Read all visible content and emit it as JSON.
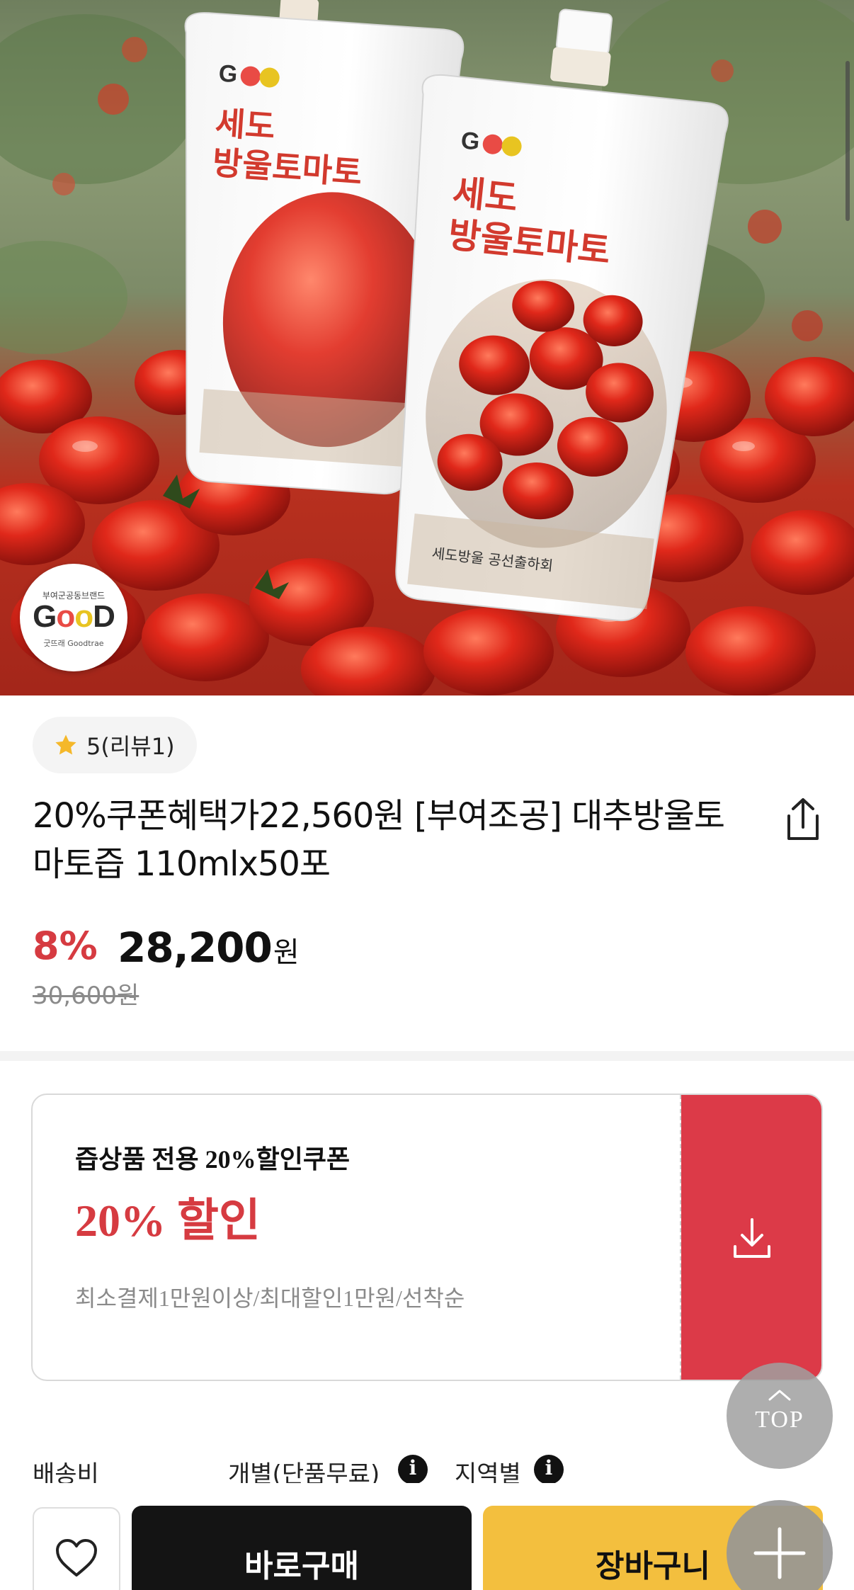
{
  "hero": {
    "badge_sub": "부여군공동브랜드",
    "badge_logo_parts": [
      "G",
      "o",
      "o",
      "D"
    ],
    "badge_name": "굿뜨래 Goodtrae"
  },
  "rating": {
    "label": "5(리뷰1)",
    "icon": "star-icon",
    "icon_color": "#f5b82a"
  },
  "product": {
    "title": "20%쿠폰혜택가22,560원 [부여조공] 대추방울토마토즙 110mlx50포",
    "discount_rate": "8%",
    "price": "28,200",
    "price_unit": "원",
    "original_price": "30,600원"
  },
  "coupon": {
    "title": "즙상품 전용 20%할인쿠폰",
    "discount": "20% 할인",
    "conditions": "최소결제1만원이상/최대할인1만원/선착순",
    "download_icon": "download-icon",
    "accent_color": "#dc3a48"
  },
  "shipping": {
    "label": "배송비",
    "type": "개별(단품무료)",
    "region": "지역별"
  },
  "top_button": {
    "label": "TOP"
  },
  "bottom_bar": {
    "wishlist_icon": "heart-icon",
    "buy_now_label": "바로구매",
    "cart_label": "장바구니",
    "buy_color": "#141414",
    "cart_color": "#f3bf3e"
  },
  "colors": {
    "accent_red": "#d63b41",
    "muted_text": "#8a8a8a"
  }
}
